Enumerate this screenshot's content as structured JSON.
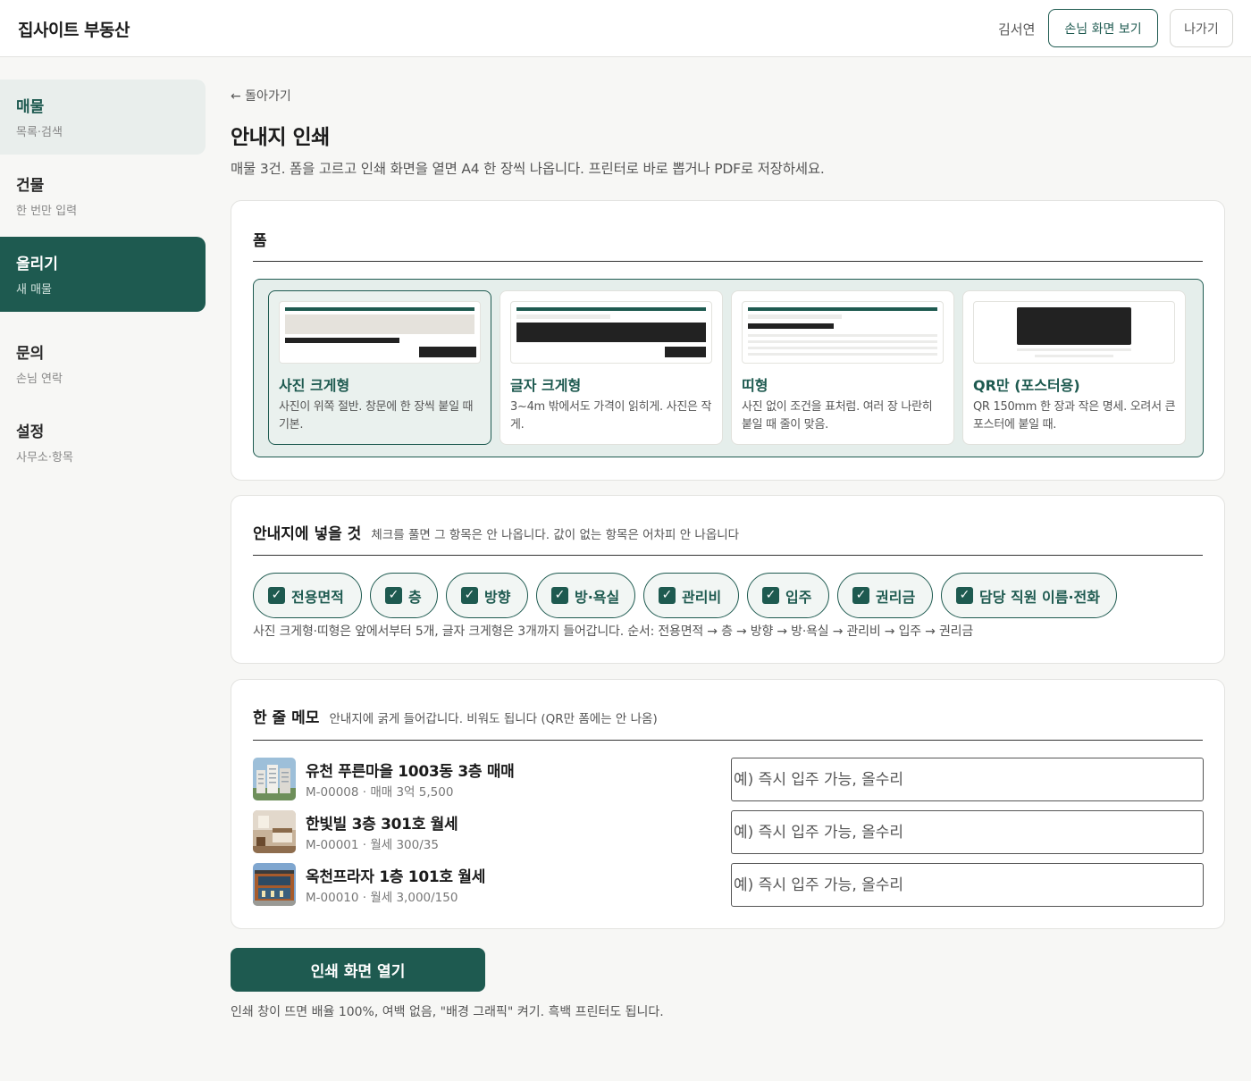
{
  "app": {
    "brand": "집사이트 부동산",
    "user_name": "김서연",
    "guest_view_label": "손님 화면 보기",
    "exit_label": "나가기"
  },
  "sidebar": {
    "items": [
      {
        "title": "매물",
        "sub": "목록·검색",
        "state": "highlight"
      },
      {
        "title": "건물",
        "sub": "한 번만 입력",
        "state": "normal"
      },
      {
        "title": "올리기",
        "sub": "새 매물",
        "state": "active"
      },
      {
        "title": "문의",
        "sub": "손님 연락",
        "state": "normal"
      },
      {
        "title": "설정",
        "sub": "사무소·항목",
        "state": "normal"
      }
    ]
  },
  "main": {
    "back_label": "← 돌아가기",
    "title": "안내지 인쇄",
    "description": "매물 3건. 폼을 고르고 인쇄 화면을 열면 A4 한 장씩 나옵니다. 프린터로 바로 뽑거나 PDF로 저장하세요.",
    "form_section": {
      "title": "폼",
      "templates": [
        {
          "name": "사진 크게형",
          "desc": "사진이 위쪽 절반. 창문에 한 장씩 붙일 때 기본.",
          "selected": true
        },
        {
          "name": "글자 크게형",
          "desc": "3~4m 밖에서도 가격이 읽히게. 사진은 작게.",
          "selected": false
        },
        {
          "name": "띠형",
          "desc": "사진 없이 조건을 표처럼. 여러 장 나란히 붙일 때 줄이 맞음.",
          "selected": false
        },
        {
          "name": "QR만 (포스터용)",
          "desc": "QR 150mm 한 장과 작은 명세. 오려서 큰 포스터에 붙일 때.",
          "selected": false
        }
      ]
    },
    "fields_section": {
      "title": "안내지에 넣을 것",
      "subtitle": "체크를 풀면 그 항목은 안 나옵니다. 값이 없는 항목은 어차피 안 나옵니다",
      "chips": [
        {
          "label": "전용면적",
          "checked": true
        },
        {
          "label": "층",
          "checked": true
        },
        {
          "label": "방향",
          "checked": true
        },
        {
          "label": "방·욕실",
          "checked": true
        },
        {
          "label": "관리비",
          "checked": true
        },
        {
          "label": "입주",
          "checked": true
        },
        {
          "label": "권리금",
          "checked": true
        },
        {
          "label": "담당 직원 이름·전화",
          "checked": true
        }
      ],
      "note": "사진 크게형·띠형은 앞에서부터 5개, 글자 크게형은 3개까지 들어갑니다. 순서: 전용면적 → 층 → 방향 → 방·욕실 → 관리비 → 입주 → 권리금"
    },
    "memo_section": {
      "title": "한 줄 메모",
      "subtitle": "안내지에 굵게 들어갑니다. 비워도 됩니다 (QR만 폼에는 안 나옴)",
      "rows": [
        {
          "title": "유천 푸른마을 1003동 3층 매매",
          "sub": "M-00008 · 매매 3억 5,500",
          "placeholder": "예) 즉시 입주 가능, 올수리",
          "value": ""
        },
        {
          "title": "한빛빌 3층 301호 월세",
          "sub": "M-00001 · 월세 300/35",
          "placeholder": "예) 즉시 입주 가능, 올수리",
          "value": ""
        },
        {
          "title": "옥천프라자 1층 101호 월세",
          "sub": "M-00010 · 월세 3,000/150",
          "placeholder": "예) 즉시 입주 가능, 올수리",
          "value": ""
        }
      ]
    },
    "print_button_label": "인쇄 화면 열기",
    "print_note": "인쇄 창이 뜨면 배율 100%, 여백 없음, \"배경 그래픽\" 켜기. 흑백 프린터도 됩니다."
  },
  "colors": {
    "accent": "#1e5a50",
    "accent_light": "#e9eeec",
    "background": "#f7f7f5"
  }
}
